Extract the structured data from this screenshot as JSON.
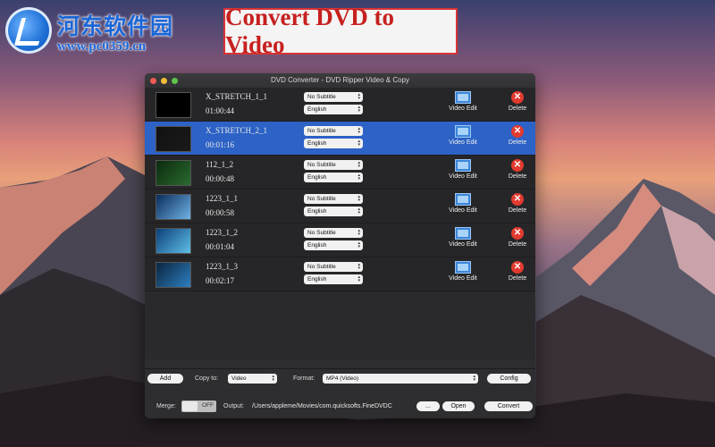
{
  "watermark": {
    "title": "河东软件园",
    "url": "www.pc0359.cn"
  },
  "banner": {
    "text": "Convert DVD to Video"
  },
  "window": {
    "title": "DVD Converter - DVD Ripper Video & Copy"
  },
  "rows": [
    {
      "name": "X_STRETCH_1_1",
      "duration": "01:00:44",
      "subtitle": "No Subtitle",
      "audio": "English",
      "edit": "Video Edit",
      "delete": "Delete",
      "selected": false
    },
    {
      "name": "X_STRETCH_2_1",
      "duration": "00:01:16",
      "subtitle": "No Subtitle",
      "audio": "English",
      "edit": "Video Edit",
      "delete": "Delete",
      "selected": true
    },
    {
      "name": "112_1_2",
      "duration": "00:00:48",
      "subtitle": "No Subtitle",
      "audio": "English",
      "edit": "Video Edit",
      "delete": "Delete",
      "selected": false
    },
    {
      "name": "1223_1_1",
      "duration": "00:00:58",
      "subtitle": "No Subtitle",
      "audio": "English",
      "edit": "Video Edit",
      "delete": "Delete",
      "selected": false
    },
    {
      "name": "1223_1_2",
      "duration": "00:01:04",
      "subtitle": "No Subtitle",
      "audio": "English",
      "edit": "Video Edit",
      "delete": "Delete",
      "selected": false
    },
    {
      "name": "1223_1_3",
      "duration": "00:02:17",
      "subtitle": "No Subtitle",
      "audio": "English",
      "edit": "Video Edit",
      "delete": "Delete",
      "selected": false
    }
  ],
  "toolbar": {
    "add_label": "Add",
    "copy_to_label": "Copy to:",
    "copy_to_value": "Video",
    "format_label": "Format:",
    "format_value": "MP4 (Video)",
    "config_label": "Config"
  },
  "footer": {
    "merge_label": "Merge:",
    "merge_state": "OFF",
    "output_label": "Output:",
    "output_path": "/Users/appleme/Movies/com.quicksofts.FineDVDC",
    "browse_label": "...",
    "open_label": "Open",
    "convert_label": "Convert"
  },
  "colors": {
    "selection": "#2d62c6",
    "window_bg": "#2d2d2f",
    "banner_text": "#c6201f"
  }
}
